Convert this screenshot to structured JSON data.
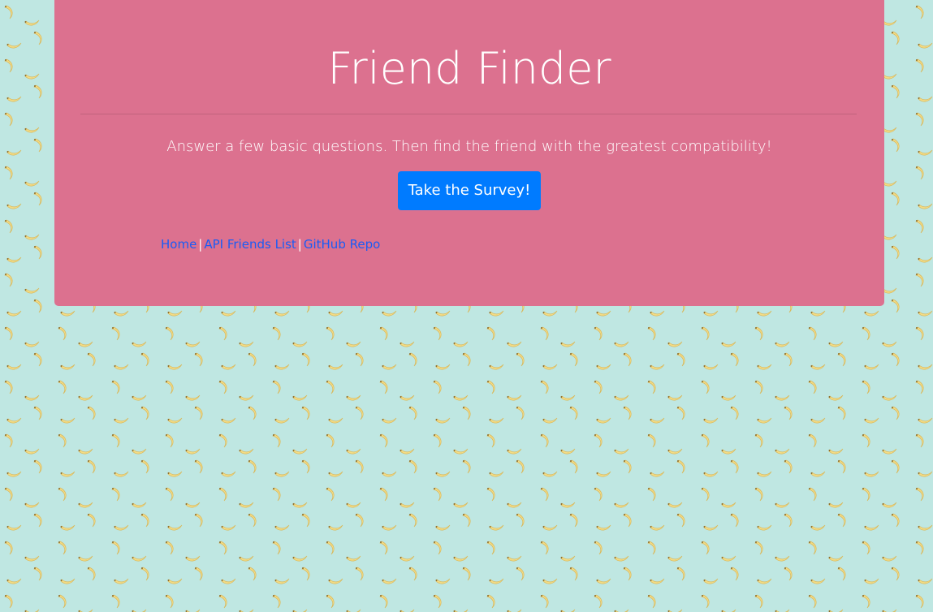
{
  "page": {
    "background_color": "#bfe7e2",
    "pattern_icon": "banana-icon"
  },
  "jumbotron": {
    "background_color": "#dc718f",
    "title": "Friend Finder",
    "lead": "Answer a few basic questions. Then find the friend with the greatest compatibility!",
    "button_label": "Take the Survey!",
    "button_color": "#007bff"
  },
  "footer": {
    "links": [
      {
        "label": "Home"
      },
      {
        "label": "API Friends List"
      },
      {
        "label": "GitHub Repo"
      }
    ],
    "separator": "|",
    "link_color": "#1a5cf5"
  }
}
